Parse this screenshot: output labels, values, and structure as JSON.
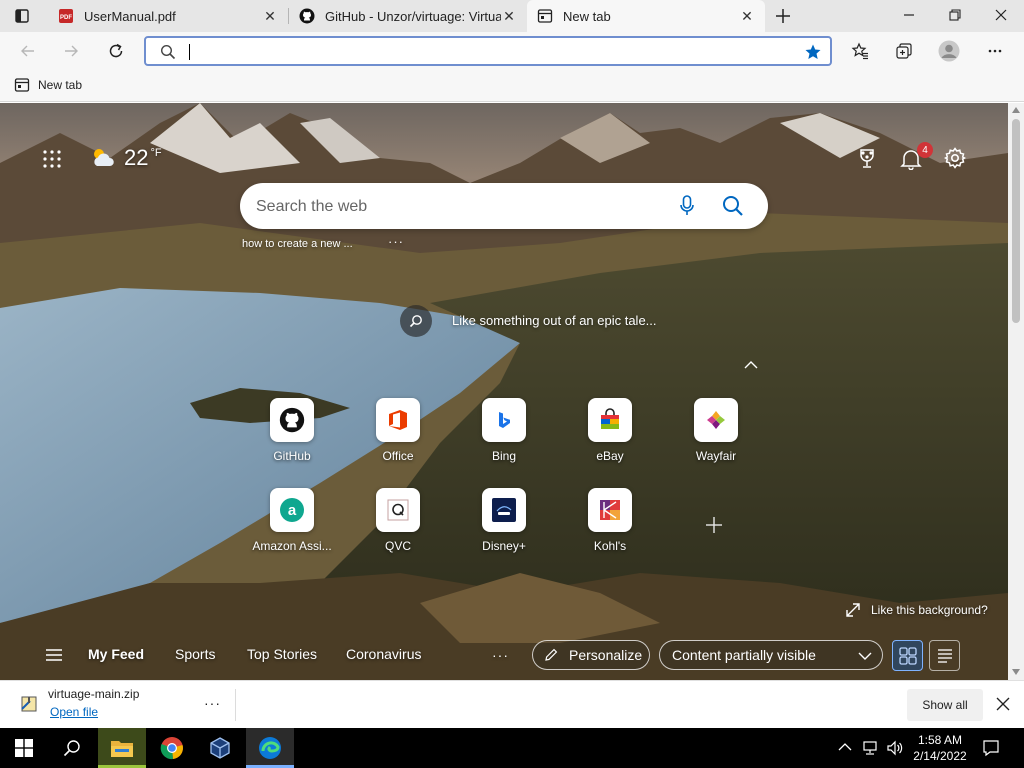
{
  "tabs": [
    {
      "title": "UserManual.pdf",
      "icon": "pdf-icon"
    },
    {
      "title": "GitHub - Unzor/virtuage: Virtuage",
      "icon": "github-icon"
    },
    {
      "title": "New tab",
      "icon": "newtab-icon"
    }
  ],
  "favorites": [
    {
      "label": "New tab"
    }
  ],
  "weather": {
    "temp": "22",
    "unit": "°F"
  },
  "notifications": {
    "count": "4"
  },
  "search": {
    "placeholder": "Search the web",
    "recent": "how to create a new ...",
    "more": "···"
  },
  "image_caption": "Like something out of an epic tale...",
  "quick_links": [
    {
      "label": "GitHub"
    },
    {
      "label": "Office"
    },
    {
      "label": "Bing"
    },
    {
      "label": "eBay"
    },
    {
      "label": "Wayfair"
    },
    {
      "label": "Amazon Assi..."
    },
    {
      "label": "QVC"
    },
    {
      "label": "Disney+"
    },
    {
      "label": "Kohl's"
    }
  ],
  "like_background": "Like this background?",
  "feed": {
    "tabs": [
      "My Feed",
      "Sports",
      "Top Stories",
      "Coronavirus"
    ],
    "more": "···",
    "personalize": "Personalize",
    "visibility": "Content partially visible"
  },
  "download": {
    "filename": "virtuage-main.zip",
    "action": "Open file",
    "more": "···",
    "show_all": "Show all"
  },
  "clock": {
    "time": "1:58 AM",
    "date": "2/14/2022"
  },
  "colors": {
    "accent": "#0067c0",
    "badge": "#d13438"
  }
}
